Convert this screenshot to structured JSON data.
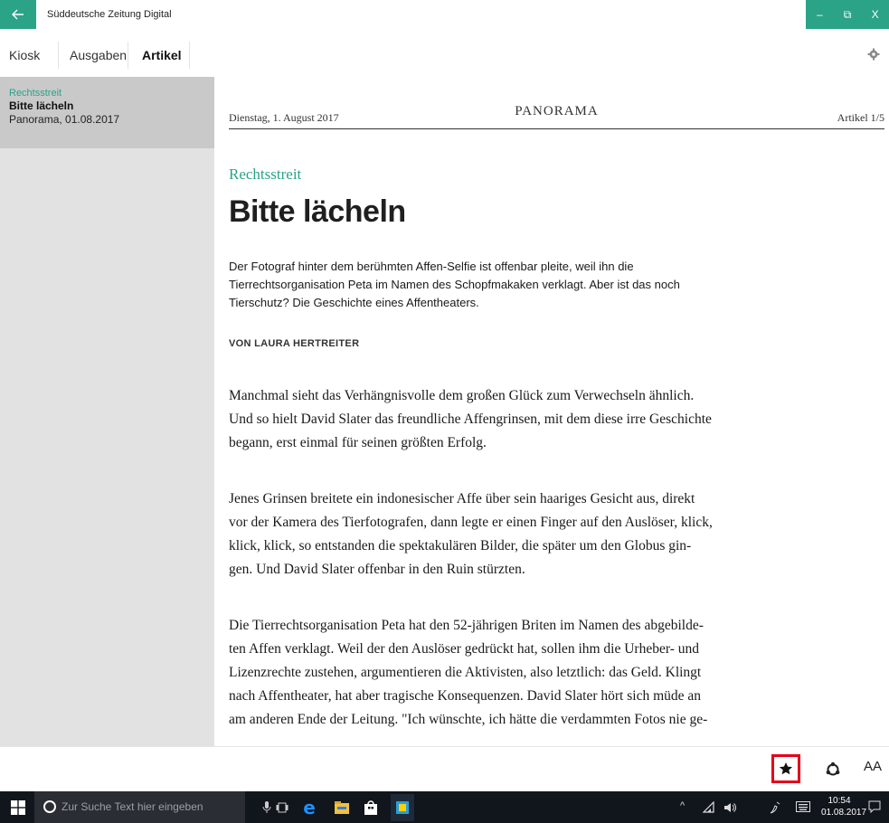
{
  "window": {
    "app_title": "Süddeutsche Zeitung Digital",
    "back_icon": "arrow-left-icon",
    "controls": {
      "minimize": "–",
      "maximize": "⧉",
      "close": "X"
    }
  },
  "nav": {
    "tabs": [
      {
        "label": "Kiosk"
      },
      {
        "label": "Ausgaben"
      },
      {
        "label": "Artikel",
        "active": true
      }
    ],
    "settings_icon": "gear-icon"
  },
  "sidebar": {
    "items": [
      {
        "kicker": "Rechtsstreit",
        "title": "Bitte lächeln",
        "meta": "Panorama, 01.08.2017",
        "selected": true
      }
    ]
  },
  "article": {
    "date": "Dienstag, 1. August 2017",
    "section": "PANORAMA",
    "counter": "Artikel 1/5",
    "kicker": "Rechtsstreit",
    "headline": "Bitte lächeln",
    "teaser_lines": [
      "Der Fotograf hinter dem berühmten Affen-Selfie ist offenbar pleite, weil ihn die",
      "Tierrechtsorganisation Peta im Namen des Schopfmakaken verklagt. Aber ist das noch",
      "Tierschutz? Die Geschichte eines Affentheaters."
    ],
    "author": "VON LAURA HERTREITER",
    "paragraphs": [
      [
        "Manchmal sieht das Verhängnisvolle dem großen Glück zum Verwechseln ähnlich.",
        "Und so hielt David Slater das freundliche Affengrinsen, mit dem diese irre Geschichte",
        "begann, erst einmal für seinen größten Erfolg."
      ],
      [
        "Jenes Grinsen breitete ein indonesischer Affe über sein haariges Gesicht aus, direkt",
        "vor der Kamera des Tierfotografen, dann legte er einen Finger auf den Auslöser, klick,",
        "klick, klick, so entstanden die spektakulären Bilder, die später um den Globus gin-",
        "gen. Und David Slater offenbar in den Ruin stürzten."
      ],
      [
        "Die Tierrechtsorganisation Peta hat den 52-jährigen Briten im Namen des abgebilde-",
        "ten Affen verklagt. Weil der den Auslöser gedrückt hat, sollen ihm die Urheber- und",
        "Lizenzrechte zustehen, argumentieren die Aktivisten, also letztlich: das Geld. Klingt",
        "nach Affentheater, hat aber tragische Konsequenzen. David Slater hört sich müde an",
        "am anderen Ende der Leitung. \"Ich wünschte, ich hätte die verdammten Fotos nie ge-"
      ]
    ]
  },
  "actions": {
    "favorite_icon": "star-icon",
    "share_icon": "share-icon",
    "font_size_label": "AA"
  },
  "taskbar": {
    "search_placeholder": "Zur Suche Text hier eingeben",
    "time": "10:54",
    "date": "01.08.2017",
    "colors": {
      "accent": "#2aa387",
      "highlight": "#e3001b"
    }
  }
}
